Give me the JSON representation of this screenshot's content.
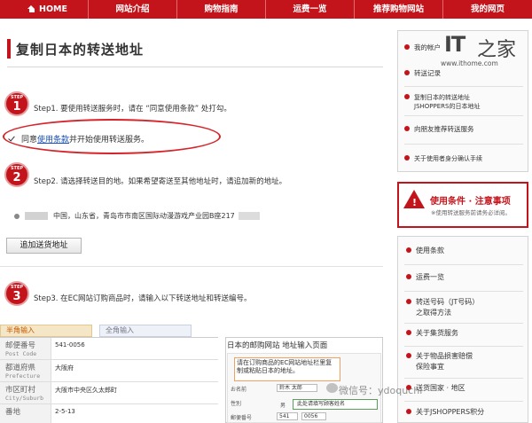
{
  "nav": {
    "home": "HOME",
    "items": [
      "网站介绍",
      "购物指南",
      "运费一览",
      "推荐购物网站",
      "我的网页"
    ]
  },
  "page_title": "复制日本的转送地址",
  "steps": [
    {
      "label": "STEP",
      "num": "1",
      "text": "Step1. 要使用转送服务时，请在 “同意使用条款” 处打勾。"
    },
    {
      "label": "STEP",
      "num": "2",
      "text": "Step2. 请选择转送目的地。如果希望寄送至其他地址时，请追加新的地址。"
    },
    {
      "label": "STEP",
      "num": "3",
      "text": "Step3. 在EC网站订购商品时，请输入以下转送地址和转送编号。"
    }
  ],
  "agree": {
    "prefix": "同意",
    "link": "使用条款",
    "suffix": "并开始使用转送服务。"
  },
  "address": "中国，山东省，青岛市市南区国际动漫游戏产业园B座217",
  "add_address_button": "追加送货地址",
  "form": {
    "tab_half": "半角输入",
    "tab_full": "全角输入",
    "rows": [
      {
        "jp": "邮便番号",
        "en": "Post Code",
        "value": "541-0056"
      },
      {
        "jp": "都道府県",
        "en": "Prefecture",
        "value": "大阪府"
      },
      {
        "jp": "市区町村",
        "en": "City/Suburb",
        "value": "大阪市中央区久太郎町"
      },
      {
        "jp": "番地",
        "en": "",
        "value": "2-5-13"
      }
    ]
  },
  "example": {
    "title": "日本的邮购网站 地址输入页面",
    "callout": "请在订购商品的EC网站地址栏里复制或粘贴日本的地址。",
    "name_label": "お名前",
    "name_value": "鈴木 太郎",
    "gender_label": "性別",
    "gender_value": "男",
    "zip_label": "郵便番号",
    "zip_1": "541",
    "zip_2": "0056",
    "green_note": "此处请填写顾客姓名"
  },
  "sidebar": {
    "logo_text": "IT",
    "logo_glyph": "之家",
    "logo_url": "www.ithome.com",
    "top_items": [
      "我的帐户",
      "转送记录",
      "复制日本的转送地址",
      "JSHOPPERS的日本地址",
      "向朋友推荐转送服务",
      "关于使用者身分确认手续"
    ],
    "warning_title": "使用条件 · 注意事项",
    "warning_sub": "※使用转送服务前请务必详阅。",
    "bottom_items": [
      "使用条款",
      "运费一览",
      "转送号码（JT号码）",
      "之取得方法",
      "关于集货服务",
      "关于物品损害赔偿",
      "保险事宜",
      "送货国家 · 地区",
      "关于JSHOPPERS积分"
    ]
  },
  "watermark": "微信号：ydoquchi",
  "colors": {
    "brand_red": "#c4141b",
    "link_blue": "#1a4fb5"
  }
}
